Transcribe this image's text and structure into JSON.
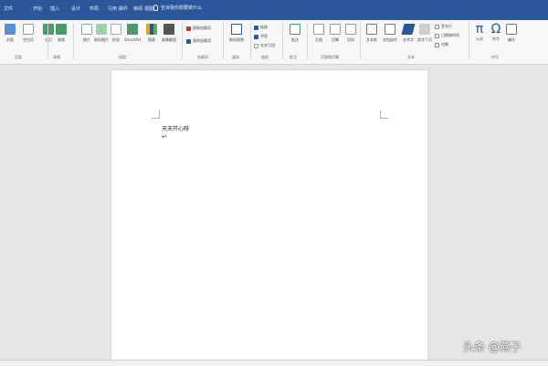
{
  "titlebar": {
    "tabs": [
      "文件",
      "开始",
      "插入",
      "设计",
      "布局",
      "引用",
      "邮件",
      "审阅",
      "视图"
    ],
    "tell_me": "告诉我你想要做什么"
  },
  "ribbon": {
    "buttons": [
      "封面",
      "空白页",
      "分页",
      "表格",
      "图片",
      "联机图片",
      "形状",
      "SmartArt",
      "图表",
      "屏幕截图",
      "联机视频",
      "链接",
      "书签",
      "交叉引用",
      "批注",
      "页眉",
      "页脚",
      "页码",
      "文本框",
      "文档部件",
      "艺术字",
      "首字下沉",
      "公式",
      "符号",
      "编号"
    ],
    "small_items": [
      "获取加载项",
      "我的加载项",
      "签名行",
      "日期和时间",
      "对象"
    ],
    "groups": [
      "页面",
      "表格",
      "插图",
      "加载项",
      "媒体",
      "链接",
      "批注",
      "页眉和页脚",
      "文本",
      "符号"
    ]
  },
  "document": {
    "line1": "天天开心呀",
    "para_mark": "↵"
  },
  "watermark": "头条 @燕子",
  "colors": {
    "accent": "#2b579a",
    "ribbon_bg": "#f7f7f7",
    "canvas_bg": "#e6e6e6",
    "page_bg": "#ffffff"
  }
}
